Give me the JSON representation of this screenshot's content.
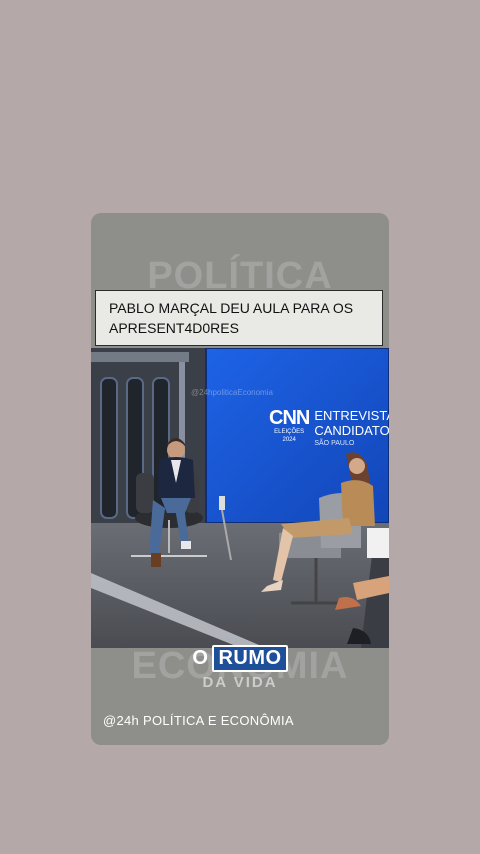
{
  "story": {
    "watermark_top": "POLÍTICA",
    "watermark_bottom": "ECONOMIA",
    "caption": "PABLO MARÇAL DEU AULA PARA OS APRESENT4D0RES",
    "video": {
      "watermark": "@24hpoliticaEconomia",
      "logo": "CNN",
      "logo_sub1": "ELEIÇÕES",
      "logo_sub2": "2024",
      "screen_title1": "ENTREVISTA",
      "screen_title2": "CANDIDATO",
      "screen_sub": "SÃO PAULO"
    },
    "overlay": {
      "prefix": "O",
      "highlight": "RUMO",
      "line2": "DA VIDA"
    },
    "handle": "@24h POLÍTICA E ECONÔMIA"
  },
  "colors": {
    "page_bg": "#b5a8a9",
    "card_bg": "#8e8f8b",
    "screen_blue": "#1c5bd6",
    "highlight_blue": "#1e4f99"
  }
}
